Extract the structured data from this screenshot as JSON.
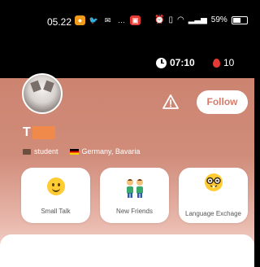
{
  "status_bar": {
    "time": "05.22",
    "battery": "59%"
  },
  "timer": {
    "value": "07:10"
  },
  "balloons": {
    "count": "10"
  },
  "profile": {
    "follow_label": "Follow",
    "name": "T",
    "occupation": "student",
    "location": "Germany, Bavaria"
  },
  "interests": [
    {
      "label": "Small Talk",
      "icon": "smile-icon"
    },
    {
      "label": "New Friends",
      "icon": "people-icon"
    },
    {
      "label": "Language Exchage",
      "icon": "nerd-face-icon"
    }
  ]
}
